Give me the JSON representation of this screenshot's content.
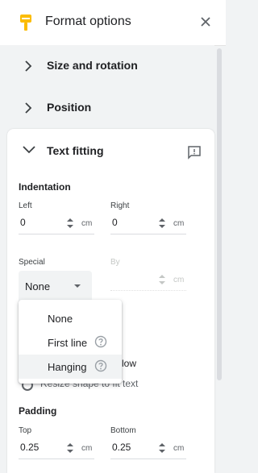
{
  "header": {
    "title": "Format options"
  },
  "sections": [
    {
      "label": "Size and rotation",
      "expanded": false
    },
    {
      "label": "Position",
      "expanded": false
    },
    {
      "label": "Text fitting",
      "expanded": true
    }
  ],
  "indentation": {
    "heading": "Indentation",
    "left": {
      "label": "Left",
      "value": "0",
      "unit": "cm"
    },
    "right": {
      "label": "Right",
      "value": "0",
      "unit": "cm"
    },
    "special": {
      "label": "Special",
      "value": "None"
    },
    "by": {
      "label": "By",
      "unit": "cm"
    }
  },
  "special_menu": {
    "options": [
      {
        "label": "None",
        "help": false,
        "selected": false
      },
      {
        "label": "First line",
        "help": true,
        "selected": false
      },
      {
        "label": "Hanging",
        "help": true,
        "selected": true
      }
    ]
  },
  "autofit": {
    "partial_option1": "low",
    "partial_option2": "Resize shape to fit text"
  },
  "padding": {
    "heading": "Padding",
    "top": {
      "label": "Top",
      "value": "0.25",
      "unit": "cm"
    },
    "bottom": {
      "label": "Bottom",
      "value": "0.25",
      "unit": "cm"
    }
  },
  "colors": {
    "accent": "#fbbc04",
    "icon": "#5f6368",
    "text": "#202124"
  }
}
